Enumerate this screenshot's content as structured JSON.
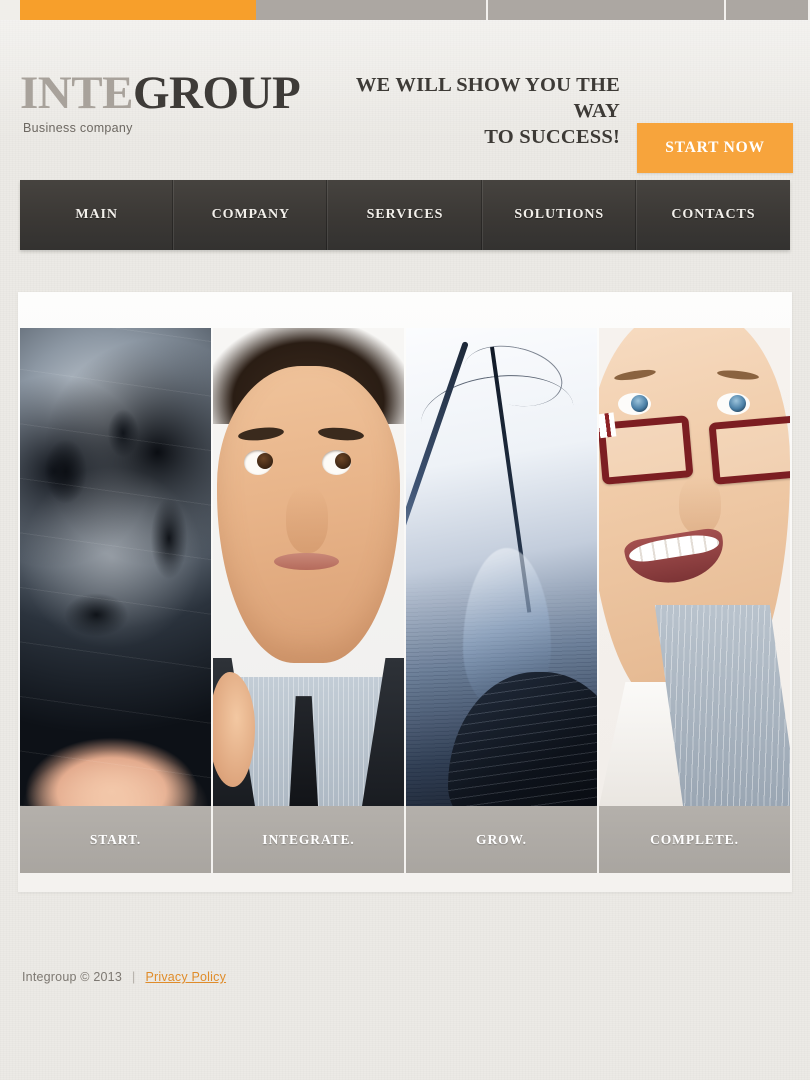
{
  "browser": {
    "tabs": [
      {
        "name": "tab-active",
        "state": "active",
        "color": "#f79f2b"
      },
      {
        "name": "tab-2",
        "state": "inactive",
        "color": "#aca7a2"
      },
      {
        "name": "tab-3",
        "state": "inactive",
        "color": "#aca7a2"
      },
      {
        "name": "tab-4",
        "state": "inactive",
        "color": "#aca7a2"
      }
    ]
  },
  "header": {
    "logo_part1": "INTE",
    "logo_part2": "GROUP",
    "tagline": "Business company",
    "slogan_line1": "WE WILL SHOW YOU THE WAY",
    "slogan_line2": "TO SUCCESS!",
    "cta_label": "START NOW",
    "accent_color": "#f7a43c"
  },
  "nav": {
    "items": [
      {
        "label": "MAIN"
      },
      {
        "label": "COMPANY"
      },
      {
        "label": "SERVICES"
      },
      {
        "label": "SOLUTIONS"
      },
      {
        "label": "CONTACTS"
      }
    ],
    "background_color": "#3b3835"
  },
  "gallery": {
    "columns": [
      {
        "caption": "START.",
        "image": "glass-globe-in-hand-photo"
      },
      {
        "caption": "INTEGRATE.",
        "image": "surprised-businessman-photo"
      },
      {
        "caption": "GROW.",
        "image": "blue-light-bulb-photo"
      },
      {
        "caption": "COMPLETE.",
        "image": "smiling-woman-with-glasses-photo"
      }
    ],
    "caption_background": "#a9a5a0"
  },
  "footer": {
    "copyright": "Integroup  © 2013",
    "separator": "|",
    "privacy_label": "Privacy Policy",
    "link_color": "#e08c2a"
  }
}
